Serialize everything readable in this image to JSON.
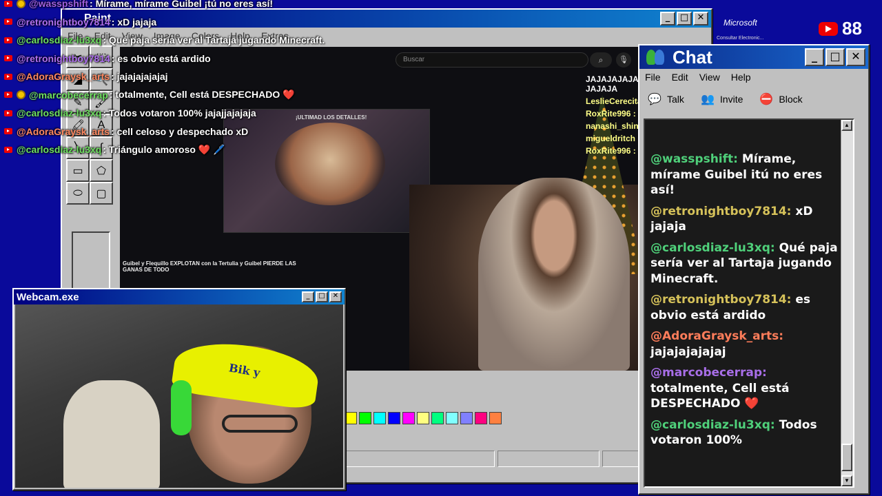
{
  "overlay_chat": [
    {
      "user": "@wasspshift",
      "msg": "Mírame, mírame Guibel ¡tú no eres así!",
      "color": "#a060e0",
      "mod": true
    },
    {
      "user": "@retronightboy7814",
      "msg": "xD jajaja",
      "color": "#b070f0",
      "mod": false
    },
    {
      "user": "@carlosdiaz-lu3xq",
      "msg": "Qué paja sería ver al Tartaja jugando Minecraft.",
      "color": "#6ee060",
      "mod": false
    },
    {
      "user": "@retronightboy7814",
      "msg": "es obvio está ardido",
      "color": "#b070f0",
      "mod": false
    },
    {
      "user": "@AdoraGraysk_arts",
      "msg": "jajajajajajaj",
      "color": "#ff8860",
      "mod": false
    },
    {
      "user": "@marcobecerrap",
      "msg": "totalmente, Cell está DESPECHADO ❤️",
      "color": "#6ee060",
      "mod": true
    },
    {
      "user": "@carlosdiaz-lu3xq",
      "msg": "Todos votaron 100% jajajjajajaja",
      "color": "#6ee060",
      "mod": false
    },
    {
      "user": "@AdoraGraysk_arts",
      "msg": "cell celoso y despechado xD",
      "color": "#ff8860",
      "mod": false
    },
    {
      "user": "@carlosdiaz-lu3xq",
      "msg": "Triángulo amoroso ❤️ 🖊️",
      "color": "#6ee060",
      "mod": false
    }
  ],
  "paint": {
    "title": "Paint",
    "menu": [
      "File",
      "Edit",
      "View",
      "Image",
      "Colors",
      "Help",
      "Extras"
    ],
    "tools": [
      "✂",
      "⬚",
      "◢",
      "🔍",
      "✎",
      "🖌",
      "🖍",
      "A",
      "╲",
      "∫",
      "▭",
      "⬠",
      "⬭",
      "▢"
    ],
    "palette": [
      "#ffff00",
      "#00ff00",
      "#00ffff",
      "#0000ff",
      "#ff00ff",
      "#ffff80",
      "#00ff80",
      "#80ffff",
      "#8080ff",
      "#ff0080",
      "#ff8040"
    ],
    "stream": {
      "search_placeholder": "Buscar",
      "search_icon": "search-icon",
      "game_title": "¡ULTIMAD LOS DETALLES!",
      "video_caption": "Guibel y Flequillo EXPLOTAN con la Tertulia y Guibel PIERDE LAS GANAS DE TODO",
      "chat": [
        {
          "user": "",
          "msg": "JAJAJAJAJAJAJAJA JAJAJA"
        },
        {
          "user": "LeslieCerecita :",
          "msg": ""
        },
        {
          "user": "RoxRite996 :",
          "msg": ""
        },
        {
          "user": "nanashi_shiny :",
          "msg": ""
        },
        {
          "user": "migueldritch :",
          "msg": ""
        },
        {
          "user": "RoxRite996 :",
          "msg": ""
        }
      ]
    }
  },
  "webcam": {
    "title": "Webcam.exe",
    "cap_text": "Bik y"
  },
  "chat_window": {
    "title": "Chat",
    "menu": [
      "File",
      "Edit",
      "View",
      "Help"
    ],
    "toolbar": [
      {
        "label": "Talk",
        "icon": "talk-icon"
      },
      {
        "label": "Invite",
        "icon": "invite-icon"
      },
      {
        "label": "Block",
        "icon": "block-icon"
      }
    ],
    "messages": [
      {
        "user": "@wasspshift:",
        "msg": "Mírame, mírame Guibel itú no eres así!",
        "color": "#4fd07a"
      },
      {
        "user": "@retronightboy7814:",
        "msg": "xD jajaja",
        "color": "#d6c25a"
      },
      {
        "user": "@carlosdiaz-lu3xq:",
        "msg": "Qué paja sería ver al Tartaja jugando Minecraft.",
        "color": "#4fd07a"
      },
      {
        "user": "@retronightboy7814:",
        "msg": "es obvio está ardido",
        "color": "#d6c25a"
      },
      {
        "user": "@AdoraGraysk_arts:",
        "msg": "jajajajajajaj",
        "color": "#ff7d5a"
      },
      {
        "user": "@marcobecerrap:",
        "msg": "totalmente, Cell está DESPECHADO ❤️",
        "color": "#a86ee8"
      },
      {
        "user": "@carlosdiaz-lu3xq:",
        "msg": "Todos votaron 100%",
        "color": "#4fd07a"
      }
    ]
  },
  "badges": {
    "microsoft": "Microsoft",
    "microsoft_sub": "Consultar Electronic...",
    "viewer_count": "88"
  }
}
